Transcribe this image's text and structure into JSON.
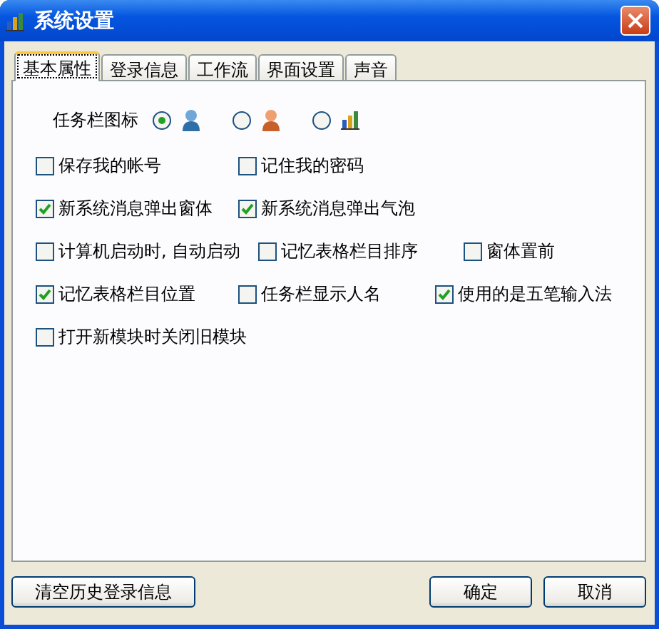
{
  "window": {
    "title": "系统设置"
  },
  "tabs": [
    {
      "label": "基本属性",
      "selected": true
    },
    {
      "label": "登录信息",
      "selected": false
    },
    {
      "label": "工作流",
      "selected": false
    },
    {
      "label": "界面设置",
      "selected": false
    },
    {
      "label": "声音",
      "selected": false
    }
  ],
  "taskbar_icon": {
    "label": "任务栏图标",
    "options": [
      {
        "kind": "person-blue",
        "selected": true
      },
      {
        "kind": "person-orange",
        "selected": false
      },
      {
        "kind": "chart",
        "selected": false
      }
    ]
  },
  "option_rows": [
    [
      {
        "label": "保存我的帐号",
        "checked": false
      },
      {
        "label": "记住我的密码",
        "checked": false
      }
    ],
    [
      {
        "label": "新系统消息弹出窗体",
        "checked": true
      },
      {
        "label": "新系统消息弹出气泡",
        "checked": true
      }
    ],
    [
      {
        "label": "计算机启动时, 自动启动",
        "checked": false
      },
      {
        "label": "记忆表格栏目排序",
        "checked": false
      },
      {
        "label": "窗体置前",
        "checked": false
      }
    ],
    [
      {
        "label": "记忆表格栏目位置",
        "checked": true
      },
      {
        "label": "任务栏显示人名",
        "checked": false
      },
      {
        "label": "使用的是五笔输入法",
        "checked": true
      }
    ],
    [
      {
        "label": "打开新模块时关闭旧模块",
        "checked": false
      }
    ]
  ],
  "buttons": [
    {
      "kind": "left",
      "label": "清空历史登录信息"
    },
    {
      "kind": "right",
      "label": "确定"
    },
    {
      "kind": "right",
      "label": "取消"
    }
  ]
}
